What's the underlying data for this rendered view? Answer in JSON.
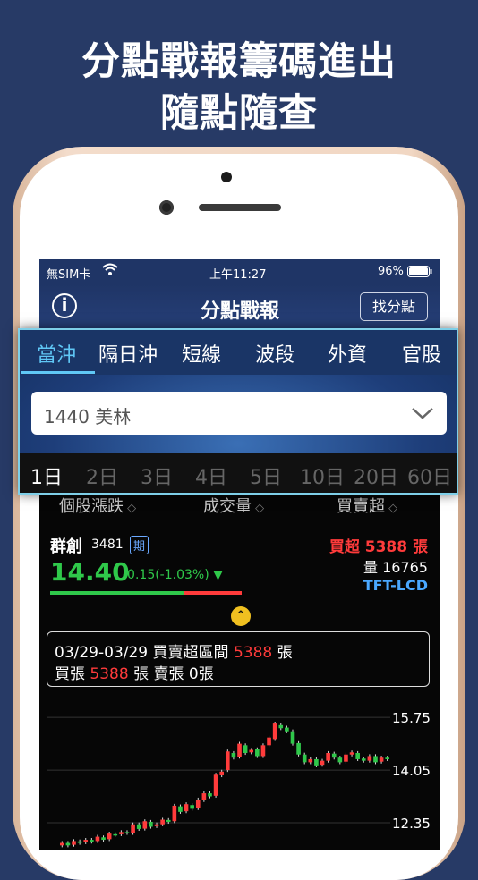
{
  "headline": {
    "line1": "分點戰報籌碼進出",
    "line2": "隨點隨查"
  },
  "status_bar": {
    "carrier": "無SIM卡",
    "time": "上午11:27",
    "battery": "96%"
  },
  "nav": {
    "title": "分點戰報",
    "find_button": "找分點"
  },
  "tabs": [
    {
      "label": "當沖",
      "active": true
    },
    {
      "label": "隔日沖",
      "active": false
    },
    {
      "label": "短線",
      "active": false
    },
    {
      "label": "波段",
      "active": false
    },
    {
      "label": "外資",
      "active": false
    },
    {
      "label": "官股",
      "active": false
    }
  ],
  "broker_select": {
    "value": "1440 美林"
  },
  "periods": [
    {
      "label": "1日",
      "active": true
    },
    {
      "label": "2日",
      "active": false
    },
    {
      "label": "3日",
      "active": false
    },
    {
      "label": "4日",
      "active": false
    },
    {
      "label": "5日",
      "active": false
    },
    {
      "label": "10日",
      "active": false
    },
    {
      "label": "20日",
      "active": false
    },
    {
      "label": "60日",
      "active": false
    }
  ],
  "columns": [
    "個股漲跌",
    "成交量",
    "買賣超"
  ],
  "stock": {
    "name": "群創",
    "code": "3481",
    "tag": "期",
    "price": "14.40",
    "change": "-0.15(-1.03%)",
    "net_label": "買超",
    "net_value": "5388 張",
    "volume": "量 16765",
    "sector": "TFT-LCD"
  },
  "summary": {
    "date_range": "03/29-03/29",
    "range_label": "買賣超區間",
    "range_value": "5388",
    "unit": "張",
    "buy_label": "買張",
    "buy_value": "5388",
    "sell_label": "賣張",
    "sell_value": "0張"
  },
  "colors": {
    "up": "#ff3b3b",
    "down": "#2fc84a",
    "accent": "#60c8f6",
    "background": "#273a66"
  },
  "chart_data": {
    "type": "candlestick",
    "y_ticks": [
      "15.75",
      "14.05",
      "12.35"
    ],
    "ylim": [
      11.6,
      16.1
    ],
    "series": [
      {
        "o": 11.62,
        "c": 11.7
      },
      {
        "o": 11.7,
        "c": 11.62
      },
      {
        "o": 11.64,
        "c": 11.76
      },
      {
        "o": 11.75,
        "c": 11.7
      },
      {
        "o": 11.72,
        "c": 11.8
      },
      {
        "o": 11.8,
        "c": 11.74
      },
      {
        "o": 11.76,
        "c": 11.9
      },
      {
        "o": 11.88,
        "c": 11.8
      },
      {
        "o": 11.82,
        "c": 12.0
      },
      {
        "o": 11.98,
        "c": 11.96
      },
      {
        "o": 11.98,
        "c": 12.05
      },
      {
        "o": 12.05,
        "c": 12.02
      },
      {
        "o": 12.02,
        "c": 12.3
      },
      {
        "o": 12.3,
        "c": 12.15
      },
      {
        "o": 12.16,
        "c": 12.4
      },
      {
        "o": 12.38,
        "c": 12.22
      },
      {
        "o": 12.24,
        "c": 12.3
      },
      {
        "o": 12.3,
        "c": 12.45
      },
      {
        "o": 12.44,
        "c": 12.38
      },
      {
        "o": 12.4,
        "c": 12.9
      },
      {
        "o": 12.88,
        "c": 12.7
      },
      {
        "o": 12.72,
        "c": 12.95
      },
      {
        "o": 12.92,
        "c": 12.8
      },
      {
        "o": 12.82,
        "c": 13.1
      },
      {
        "o": 13.08,
        "c": 13.3
      },
      {
        "o": 13.3,
        "c": 13.2
      },
      {
        "o": 13.22,
        "c": 13.9
      },
      {
        "o": 13.88,
        "c": 14.0
      },
      {
        "o": 14.05,
        "c": 14.65
      },
      {
        "o": 14.6,
        "c": 14.45
      },
      {
        "o": 14.48,
        "c": 14.9
      },
      {
        "o": 14.85,
        "c": 14.6
      },
      {
        "o": 14.62,
        "c": 14.7
      },
      {
        "o": 14.72,
        "c": 14.5
      },
      {
        "o": 14.5,
        "c": 14.85
      },
      {
        "o": 14.85,
        "c": 15.1
      },
      {
        "o": 15.05,
        "c": 15.55
      },
      {
        "o": 15.5,
        "c": 15.4
      },
      {
        "o": 15.42,
        "c": 15.3
      },
      {
        "o": 15.3,
        "c": 14.9
      },
      {
        "o": 14.92,
        "c": 14.55
      },
      {
        "o": 14.55,
        "c": 14.3
      },
      {
        "o": 14.3,
        "c": 14.4
      },
      {
        "o": 14.4,
        "c": 14.2
      },
      {
        "o": 14.22,
        "c": 14.35
      },
      {
        "o": 14.35,
        "c": 14.6
      },
      {
        "o": 14.58,
        "c": 14.45
      },
      {
        "o": 14.45,
        "c": 14.3
      },
      {
        "o": 14.32,
        "c": 14.55
      },
      {
        "o": 14.55,
        "c": 14.62
      },
      {
        "o": 14.6,
        "c": 14.4
      },
      {
        "o": 14.42,
        "c": 14.35
      },
      {
        "o": 14.35,
        "c": 14.5
      },
      {
        "o": 14.5,
        "c": 14.3
      },
      {
        "o": 14.32,
        "c": 14.45
      },
      {
        "o": 14.45,
        "c": 14.4
      }
    ]
  }
}
